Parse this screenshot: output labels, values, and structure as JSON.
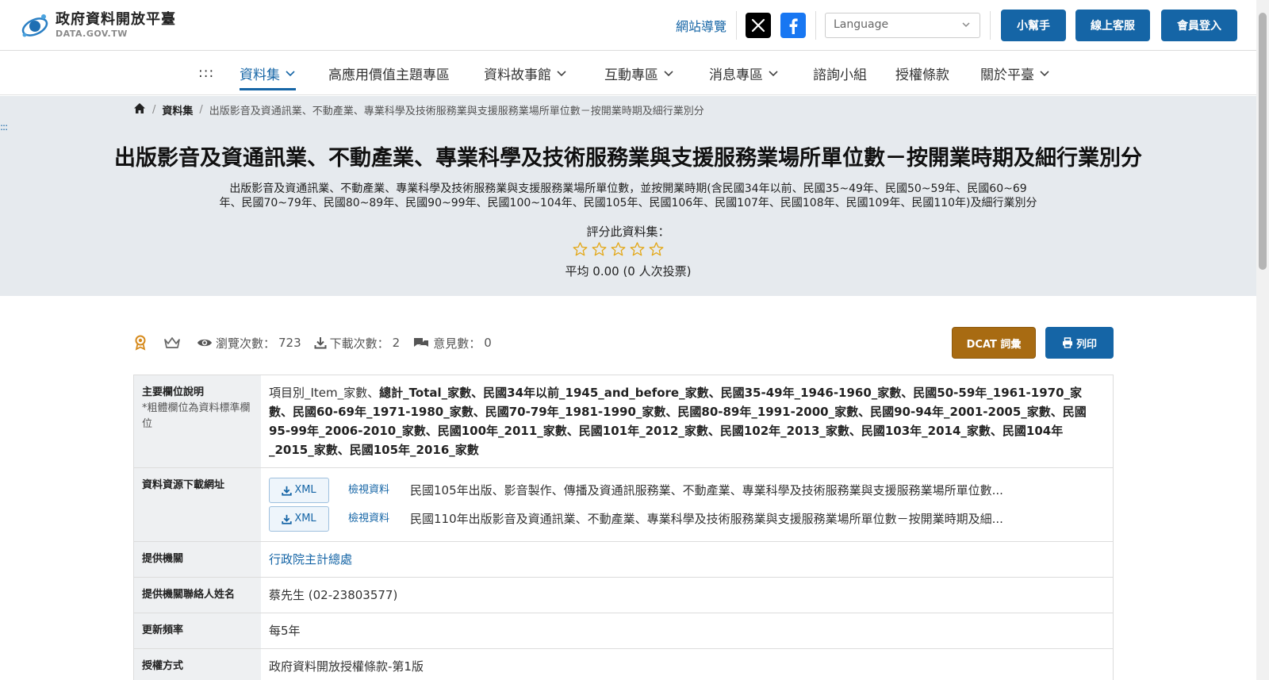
{
  "header": {
    "logo_cn": "政府資料開放平臺",
    "logo_en": "DATA.GOV.TW",
    "sitemap": "網站導覽",
    "language_placeholder": "Language",
    "helper": "小幫手",
    "support": "線上客服",
    "login": "會員登入",
    "colors": {
      "primary": "#1565a6",
      "dcat": "#a86b12"
    }
  },
  "nav": {
    "menu_dots": ":::",
    "items": [
      {
        "label": "資料集"
      },
      {
        "label": "高應用價值主題專區"
      },
      {
        "label": "資料故事館"
      },
      {
        "label": "互動專區"
      },
      {
        "label": "消息專區"
      },
      {
        "label": "諮詢小組"
      },
      {
        "label": "授權條款"
      },
      {
        "label": "關於平臺"
      }
    ]
  },
  "breadcrumb": {
    "datasets": "資料集",
    "current": "出版影音及資通訊業、不動產業、專業科學及技術服務業與支援服務業場所單位數－按開業時期及細行業別分"
  },
  "side_dots": ":::",
  "dataset": {
    "title": "出版影音及資通訊業、不動產業、專業科學及技術服務業與支援服務業場所單位數－按開業時期及細行業別分",
    "description_line1": "出版影音及資通訊業、不動產業、專業科學及技術服務業與支援服務業場所單位數，並按開業時期(含民國34年以前、民國35~49年、民國50~59年、民國60~69",
    "description_line2": "年、民國70~79年、民國80~89年、民國90~99年、民國100~104年、民國105年、民國106年、民國107年、民國108年、民國109年、民國110年)及細行業別分",
    "rate_label": "評分此資料集：",
    "rating": 0,
    "rating_max": 5,
    "average": "平均 0.00 (0 人次投票)"
  },
  "stats": {
    "views_label": "瀏覽次數：",
    "views": "723",
    "downloads_label": "下載次數：",
    "downloads": "2",
    "comments_label": "意見數：",
    "comments": "0"
  },
  "actions": {
    "dcat": "DCAT 詞彙",
    "print": "列印"
  },
  "table": {
    "fields_label": "主要欄位說明",
    "fields_note": "*粗體欄位為資料標準欄位",
    "fields_plain": "項目別_Item_家數、",
    "fields_bold": "總計_Total_家數、民國34年以前_1945_and_before_家數、民國35-49年_1946-1960_家數、民國50-59年_1961-1970_家數、民國60-69年_1971-1980_家數、民國70-79年_1981-1990_家數、民國80-89年_1991-2000_家數、民國90-94年_2001-2005_家數、民國95-99年_2006-2010_家數、民國100年_2011_家數、民國101年_2012_家數、民國102年_2013_家數、民國103年_2014_家數、民國104年_2015_家數、民國105年_2016_家數",
    "resources_label": "資料資源下載網址",
    "resources": [
      {
        "format": "XML",
        "view": "檢視資料",
        "name": "民國105年出版、影音製作、傳播及資通訊服務業、不動產業、專業科學及技術服務業與支援服務業場所單位數..."
      },
      {
        "format": "XML",
        "view": "檢視資料",
        "name": "民國110年出版影音及資通訊業、不動產業、專業科學及技術服務業與支援服務業場所單位數－按開業時期及細..."
      }
    ],
    "agency_label": "提供機關",
    "agency": "行政院主計總處",
    "contact_label": "提供機關聯絡人姓名",
    "contact": "蔡先生 (02-23803577)",
    "frequency_label": "更新頻率",
    "frequency": "每5年",
    "license_label": "授權方式",
    "license": "政府資料開放授權條款-第1版"
  }
}
